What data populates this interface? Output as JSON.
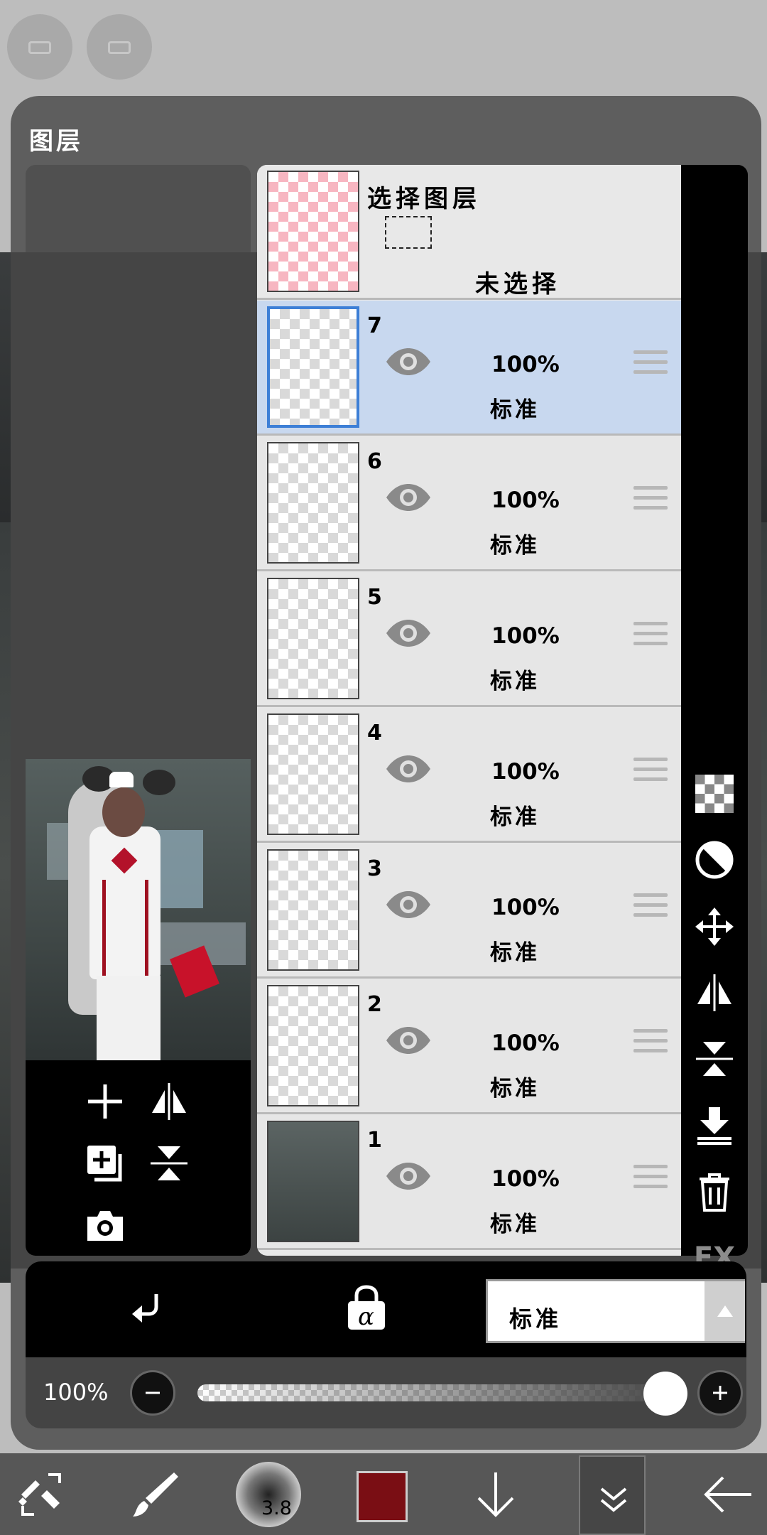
{
  "window_title": "图层",
  "select_layer": {
    "title": "选择图层",
    "status": "未选择"
  },
  "layers": [
    {
      "number": "7",
      "opacity": "100%",
      "blend": "标准",
      "selected": true
    },
    {
      "number": "6",
      "opacity": "100%",
      "blend": "标准",
      "selected": false
    },
    {
      "number": "5",
      "opacity": "100%",
      "blend": "标准",
      "selected": false
    },
    {
      "number": "4",
      "opacity": "100%",
      "blend": "标准",
      "selected": false
    },
    {
      "number": "3",
      "opacity": "100%",
      "blend": "标准",
      "selected": false
    },
    {
      "number": "2",
      "opacity": "100%",
      "blend": "标准",
      "selected": false
    },
    {
      "number": "1",
      "opacity": "100%",
      "blend": "标准",
      "selected": false
    }
  ],
  "right_tools": {
    "fx_label": "FX"
  },
  "bottom": {
    "blend_mode": "标准",
    "alpha_label": "α"
  },
  "opacity_control": {
    "label": "100%",
    "value": 1.0
  },
  "toolbar": {
    "brush_size": "3.8",
    "color": "#7a0e14"
  },
  "icons": {
    "eye": "eye-icon",
    "handle": "drag-handle-icon",
    "checker": "checkerboard-icon",
    "mask": "mask-icon",
    "move": "move-icon",
    "flip_h": "flip-horizontal-icon",
    "flip_v": "flip-vertical-icon",
    "merge_down": "merge-down-icon",
    "trash": "trash-icon",
    "more": "more-icon"
  }
}
